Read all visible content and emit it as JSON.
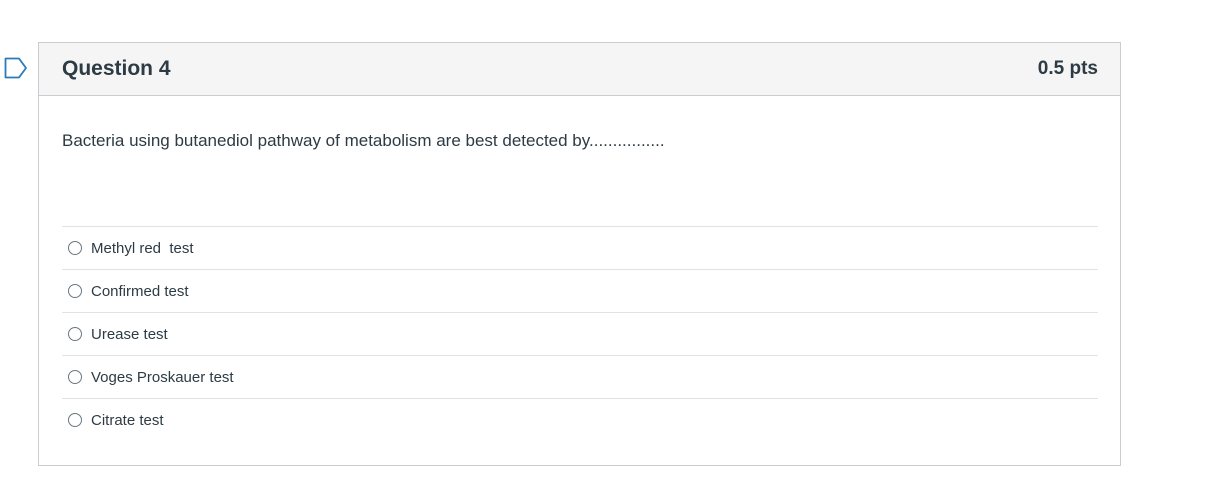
{
  "question": {
    "title": "Question 4",
    "points": "0.5 pts",
    "text": "Bacteria using butanediol pathway of metabolism are best detected by................",
    "flag_icon": "flag-outline-icon",
    "answers": [
      {
        "label": "Methyl red  test",
        "selected": false
      },
      {
        "label": "Confirmed test",
        "selected": false
      },
      {
        "label": "Urease test",
        "selected": false
      },
      {
        "label": "Voges Proskauer test",
        "selected": false
      },
      {
        "label": "Citrate test",
        "selected": false
      }
    ]
  },
  "colors": {
    "flag": "#2b7abc",
    "header_bg": "#f5f5f5",
    "border": "#c7cdd1",
    "text": "#2d3b45"
  }
}
